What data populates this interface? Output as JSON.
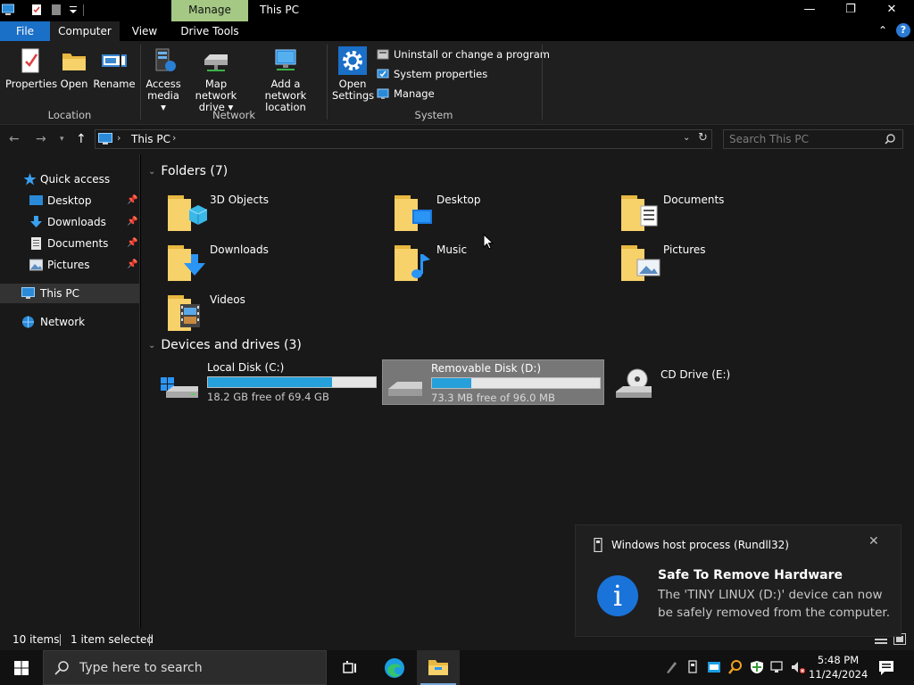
{
  "window": {
    "title": "This PC",
    "contextual_tab": "Manage"
  },
  "tabs": {
    "file": "File",
    "computer": "Computer",
    "view": "View",
    "drive_tools": "Drive Tools"
  },
  "ribbon": {
    "location": {
      "label": "Location",
      "properties": "Properties",
      "open": "Open",
      "rename": "Rename"
    },
    "network": {
      "label": "Network",
      "access_media_1": "Access",
      "access_media_2": "media",
      "map_drive_1": "Map network",
      "map_drive_2": "drive",
      "add_location_1": "Add a network",
      "add_location_2": "location"
    },
    "system": {
      "label": "System",
      "open_settings_1": "Open",
      "open_settings_2": "Settings",
      "uninstall": "Uninstall or change a program",
      "system_properties": "System properties",
      "manage": "Manage"
    }
  },
  "address": {
    "path": "This PC",
    "search_placeholder": "Search This PC"
  },
  "sidebar": {
    "quick_access": "Quick access",
    "pinned": [
      {
        "label": "Desktop"
      },
      {
        "label": "Downloads"
      },
      {
        "label": "Documents"
      },
      {
        "label": "Pictures"
      }
    ],
    "this_pc": "This PC",
    "network": "Network"
  },
  "folders": {
    "header": "Folders (7)",
    "items": [
      {
        "label": "3D Objects"
      },
      {
        "label": "Desktop"
      },
      {
        "label": "Documents"
      },
      {
        "label": "Downloads"
      },
      {
        "label": "Music"
      },
      {
        "label": "Pictures"
      },
      {
        "label": "Videos"
      }
    ]
  },
  "drives": {
    "header": "Devices and drives (3)",
    "items": [
      {
        "name": "Local Disk (C:)",
        "free": "18.2 GB free of 69.4 GB",
        "used_fraction": 0.738
      },
      {
        "name": "Removable Disk (D:)",
        "free": "73.3 MB free of 96.0 MB",
        "used_fraction": 0.236
      },
      {
        "name": "CD Drive (E:)"
      }
    ]
  },
  "status": {
    "items": "10 items",
    "selected": "1 item selected"
  },
  "toast": {
    "app": "Windows host process (Rundll32)",
    "title": "Safe To Remove Hardware",
    "body": "The 'TINY LINUX (D:)' device can now be safely removed from the computer."
  },
  "taskbar": {
    "search_placeholder": "Type here to search",
    "time": "5:48 PM",
    "date": "11/24/2024"
  },
  "colors": {
    "accent": "#1a6fc7",
    "manage_tab": "#a5c985",
    "progress": "#26a0da"
  }
}
